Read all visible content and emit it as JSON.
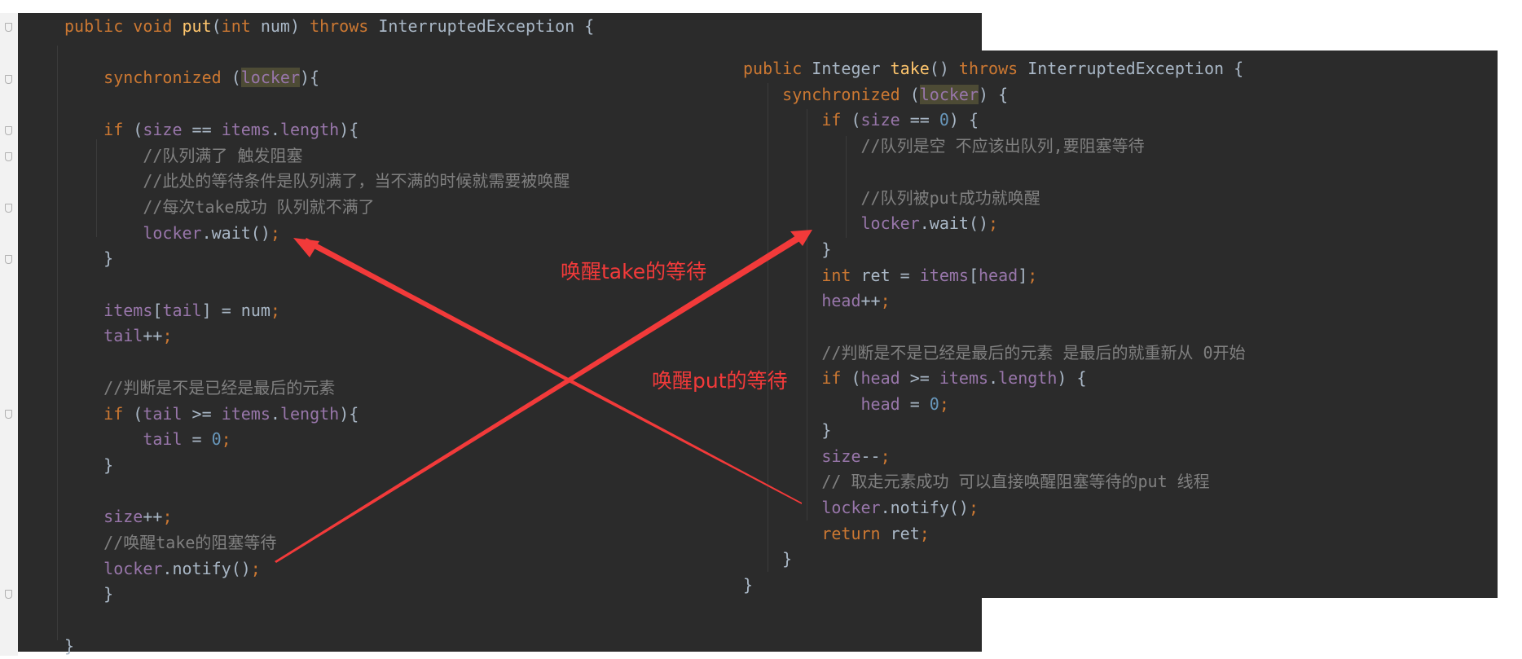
{
  "colors": {
    "background": "#2b2b2b",
    "keyword": "#cc7832",
    "method": "#ffc66d",
    "field": "#9876aa",
    "text": "#a9b7c6",
    "comment": "#808080",
    "number": "#6897bb",
    "annotation": "#f23a3a"
  },
  "left_code": [
    [
      [
        "kw",
        "public void "
      ],
      [
        "fn",
        "put"
      ],
      [
        "pl",
        "("
      ],
      [
        "kw",
        "int "
      ],
      [
        "pl",
        "num) "
      ],
      [
        "kw",
        "throws "
      ],
      [
        "pl",
        "InterruptedException {"
      ]
    ],
    [],
    [
      [
        "pl",
        "    "
      ],
      [
        "kw",
        "synchronized "
      ],
      [
        "pl",
        "("
      ],
      [
        "fd hl",
        "locker"
      ],
      [
        "pl",
        "){"
      ]
    ],
    [],
    [
      [
        "pl",
        "    "
      ],
      [
        "kw",
        "if "
      ],
      [
        "pl",
        "("
      ],
      [
        "fd",
        "size"
      ],
      [
        "pl",
        " == "
      ],
      [
        "fd",
        "items"
      ],
      [
        "pl",
        "."
      ],
      [
        "fd",
        "length"
      ],
      [
        "pl",
        "){"
      ]
    ],
    [
      [
        "pl",
        "        "
      ],
      [
        "cm",
        "//队列满了 触发阻塞"
      ]
    ],
    [
      [
        "pl",
        "        "
      ],
      [
        "cm",
        "//此处的等待条件是队列满了，当不满的时候就需要被唤醒"
      ]
    ],
    [
      [
        "pl",
        "        "
      ],
      [
        "cm",
        "//每次take成功 队列就不满了"
      ]
    ],
    [
      [
        "pl",
        "        "
      ],
      [
        "fd",
        "locker"
      ],
      [
        "pl",
        ".wait()"
      ],
      [
        "sc",
        ";"
      ]
    ],
    [
      [
        "pl",
        "    }"
      ]
    ],
    [],
    [
      [
        "pl",
        "    "
      ],
      [
        "fd",
        "items"
      ],
      [
        "pl",
        "["
      ],
      [
        "fd",
        "tail"
      ],
      [
        "pl",
        "] = num"
      ],
      [
        "sc",
        ";"
      ]
    ],
    [
      [
        "pl",
        "    "
      ],
      [
        "fd",
        "tail"
      ],
      [
        "pl",
        "++"
      ],
      [
        "sc",
        ";"
      ]
    ],
    [],
    [
      [
        "pl",
        "    "
      ],
      [
        "cm",
        "//判断是不是已经是最后的元素"
      ]
    ],
    [
      [
        "pl",
        "    "
      ],
      [
        "kw",
        "if "
      ],
      [
        "pl",
        "("
      ],
      [
        "fd",
        "tail"
      ],
      [
        "pl",
        " >= "
      ],
      [
        "fd",
        "items"
      ],
      [
        "pl",
        "."
      ],
      [
        "fd",
        "length"
      ],
      [
        "pl",
        "){"
      ]
    ],
    [
      [
        "pl",
        "        "
      ],
      [
        "fd",
        "tail"
      ],
      [
        "pl",
        " = "
      ],
      [
        "nm",
        "0"
      ],
      [
        "sc",
        ";"
      ]
    ],
    [
      [
        "pl",
        "    }"
      ]
    ],
    [],
    [
      [
        "pl",
        "    "
      ],
      [
        "fd",
        "size"
      ],
      [
        "pl",
        "++"
      ],
      [
        "sc",
        ";"
      ]
    ],
    [
      [
        "pl",
        "    "
      ],
      [
        "cm",
        "//唤醒take的阻塞等待"
      ]
    ],
    [
      [
        "pl",
        "    "
      ],
      [
        "fd",
        "locker"
      ],
      [
        "pl",
        ".notify()"
      ],
      [
        "sc",
        ";"
      ]
    ],
    [
      [
        "pl",
        "    }"
      ]
    ],
    [],
    [
      [
        "pl",
        "}"
      ]
    ]
  ],
  "right_code": [
    [
      [
        "kw",
        "public "
      ],
      [
        "pl",
        "Integer "
      ],
      [
        "fn",
        "take"
      ],
      [
        "pl",
        "() "
      ],
      [
        "kw",
        "throws "
      ],
      [
        "pl",
        "InterruptedException {"
      ]
    ],
    [
      [
        "pl",
        "    "
      ],
      [
        "kw",
        "synchronized "
      ],
      [
        "pl",
        "("
      ],
      [
        "fd hl",
        "locker"
      ],
      [
        "pl",
        ") {"
      ]
    ],
    [
      [
        "pl",
        "        "
      ],
      [
        "kw",
        "if "
      ],
      [
        "pl",
        "("
      ],
      [
        "fd",
        "size"
      ],
      [
        "pl",
        " == "
      ],
      [
        "nm",
        "0"
      ],
      [
        "pl",
        ") {"
      ]
    ],
    [
      [
        "pl",
        "            "
      ],
      [
        "cm",
        "//队列是空 不应该出队列,要阻塞等待"
      ]
    ],
    [],
    [
      [
        "pl",
        "            "
      ],
      [
        "cm",
        "//队列被put成功就唤醒"
      ]
    ],
    [
      [
        "pl",
        "            "
      ],
      [
        "fd",
        "locker"
      ],
      [
        "pl",
        ".wait()"
      ],
      [
        "sc",
        ";"
      ]
    ],
    [
      [
        "pl",
        "        }"
      ]
    ],
    [
      [
        "pl",
        "        "
      ],
      [
        "kw",
        "int "
      ],
      [
        "pl",
        "ret = "
      ],
      [
        "fd",
        "items"
      ],
      [
        "pl",
        "["
      ],
      [
        "fd",
        "head"
      ],
      [
        "pl",
        "]"
      ],
      [
        "sc",
        ";"
      ]
    ],
    [
      [
        "pl",
        "        "
      ],
      [
        "fd",
        "head"
      ],
      [
        "pl",
        "++"
      ],
      [
        "sc",
        ";"
      ]
    ],
    [],
    [
      [
        "pl",
        "        "
      ],
      [
        "cm",
        "//判断是不是已经是最后的元素 是最后的就重新从 0开始"
      ]
    ],
    [
      [
        "pl",
        "        "
      ],
      [
        "kw",
        "if "
      ],
      [
        "pl",
        "("
      ],
      [
        "fd",
        "head"
      ],
      [
        "pl",
        " >= "
      ],
      [
        "fd",
        "items"
      ],
      [
        "pl",
        "."
      ],
      [
        "fd",
        "length"
      ],
      [
        "pl",
        ") {"
      ]
    ],
    [
      [
        "pl",
        "            "
      ],
      [
        "fd",
        "head"
      ],
      [
        "pl",
        " = "
      ],
      [
        "nm",
        "0"
      ],
      [
        "sc",
        ";"
      ]
    ],
    [
      [
        "pl",
        "        }"
      ]
    ],
    [
      [
        "pl",
        "        "
      ],
      [
        "fd",
        "size"
      ],
      [
        "pl",
        "--"
      ],
      [
        "sc",
        ";"
      ]
    ],
    [
      [
        "pl",
        "        "
      ],
      [
        "cm",
        "// 取走元素成功 可以直接唤醒阻塞等待的put 线程"
      ]
    ],
    [
      [
        "pl",
        "        "
      ],
      [
        "fd",
        "locker"
      ],
      [
        "pl",
        ".notify()"
      ],
      [
        "sc",
        ";"
      ]
    ],
    [
      [
        "pl",
        "        "
      ],
      [
        "kw",
        "return "
      ],
      [
        "pl",
        "ret"
      ],
      [
        "sc",
        ";"
      ]
    ],
    [
      [
        "pl",
        "    }"
      ]
    ],
    [
      [
        "pl",
        "}"
      ]
    ]
  ],
  "annotations": {
    "wake_take": "唤醒take的等待",
    "wake_put": "唤醒put的等待"
  }
}
